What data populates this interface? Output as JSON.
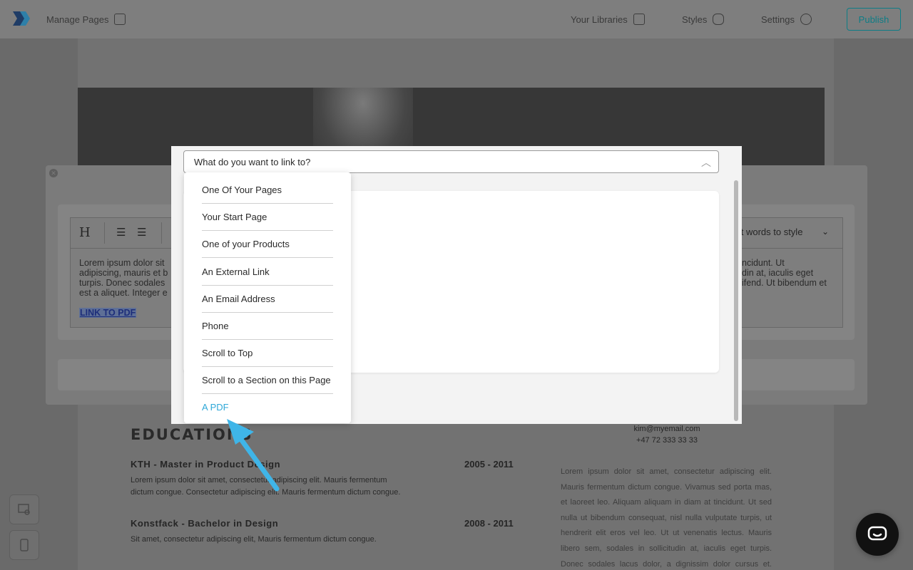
{
  "topbar": {
    "manage_pages": "Manage Pages",
    "your_libraries": "Your Libraries",
    "styles": "Styles",
    "settings": "Settings",
    "publish": "Publish"
  },
  "resume": {
    "educations_title": "EDUCATIONS",
    "edu": [
      {
        "title": "KTH - Master in Product Design",
        "years": "2005 - 2011",
        "desc": "Lorem ipsum dolor sit amet, consectetur adipiscing elit. Mauris fermentum dictum congue. Consectetur adipiscing elit. Mauris fermentum dictum congue."
      },
      {
        "title": "Konstfack - Bachelor in Design",
        "years": "2008 - 2011",
        "desc": "Sit amet, consectetur adipiscing elit, Mauris fermentum dictum congue."
      }
    ],
    "email": "kim@myemail.com",
    "phone": "+47 72 333 33 33",
    "right_para": "Lorem ipsum dolor sit amet, consectetur adipiscing elit. Mauris fermentum dictum congue. Vivamus sed porta mas, et laoreet leo. Aliquam aliquam in diam at tincidunt. Ut sed nulla ut bibendum consequat, nisl nulla vulputate turpis, ut hendrerit elit eros vel leo. Ut ut venenatis lectus. Mauris libero sem, sodales in sollicitudin at, iaculis eget turpis. Donec sodales lacus dolor, a dignissim dolor cursus et. Donec at"
  },
  "editor": {
    "heading_btn": "H",
    "style_select": "ect words to style",
    "text_left_1": "Lorem ipsum dolor sit",
    "text_left_2": "adipiscing, mauris et b",
    "text_left_3": "turpis. Donec sodales",
    "text_left_4": "est a aliquet. Integer e",
    "text_right_1": "ncidunt. Ut",
    "text_right_2": "din at, iaculis eget",
    "text_right_3": "ifend. Ut bibendum et",
    "link_text": "LINK TO PDF"
  },
  "modal": {
    "select_value": "What do you want to link to?",
    "options": [
      "One Of Your Pages",
      "Your Start Page",
      "One of your Products",
      "An External Link",
      "An Email Address",
      "Phone",
      "Scroll to Top",
      "Scroll to a Section on this Page",
      "A PDF"
    ],
    "active_option": "A PDF"
  },
  "colors": {
    "accent": "#2fa8d8",
    "publish": "#0d7d86",
    "arrow": "#3fb5e8"
  },
  "icons": {
    "logo": "logo-icon",
    "chat": "chat-icon"
  }
}
